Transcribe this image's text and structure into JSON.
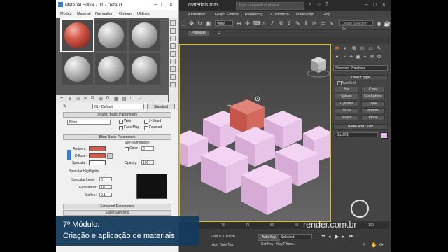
{
  "material_editor": {
    "title": "Material Editor - 01 - Default",
    "menu": [
      "Modes",
      "Material",
      "Navigation",
      "Options",
      "Utilities"
    ],
    "material_name": "01 - Default",
    "material_type": "Standard",
    "rollouts": {
      "shader_basic": "Shader Basic Parameters",
      "blinn_basic": "Blinn Basic Parameters",
      "extended": "Extended Parameters",
      "supersampling": "SuperSampling"
    },
    "shader": {
      "type": "Blinn",
      "wire": "Wire",
      "two_sided": "2-Sided",
      "face_map": "Face Map",
      "faceted": "Faceted"
    },
    "blinn": {
      "self_illumination": "Self-Illumination",
      "color_label": "Color",
      "color_value": "0",
      "ambient": "Ambient:",
      "diffuse": "Diffuse:",
      "specular": "Specular:",
      "opacity_label": "Opacity:",
      "opacity_value": "100",
      "specular_highlights": "Specular Highlights",
      "specular_level_label": "Specular Level:",
      "specular_level_value": "0",
      "glossiness_label": "Glossiness:",
      "glossiness_value": "10",
      "soften_label": "Soften:",
      "soften_value": "0.1",
      "ambient_color": "#d45a4a",
      "diffuse_color": "#d45a4a",
      "specular_color": "#ffffff"
    }
  },
  "max": {
    "title": "materiais.max",
    "search_placeholder": "Type a keyword or phrase",
    "menu": [
      "Animation",
      "Graph Editors",
      "Rendering",
      "Customize",
      "MAXScript",
      "Help"
    ],
    "selection_set_placeholder": "Create Selection Se",
    "view_dropdown": "View",
    "populate": "Populate",
    "command_panel": {
      "dropdown": "Standard Primitives",
      "object_type": "Object Type",
      "autogrid": "AutoGrid",
      "buttons": [
        "Box",
        "Cone",
        "Sphere",
        "GeoSphere",
        "Cylinder",
        "Tube",
        "Torus",
        "Pyramid",
        "Teapot",
        "Plane"
      ],
      "name_and_color": "Name and Color",
      "object_name": "Box001",
      "object_color": "#e6b9e6"
    },
    "timeline_ticks": [
      "70",
      "75",
      "80",
      "85",
      "90",
      "95",
      "100"
    ],
    "status": {
      "grid": "Grid = 10,0cm",
      "auto_key": "Auto Key",
      "selected": "Selected",
      "set_key": "Set Key",
      "key_filters": "Key Filters...",
      "add_time_tag": "Add Time Tag"
    }
  },
  "watermark": "render.com.br",
  "lesson": {
    "line1": "7º Módulo:",
    "line2": "Criação e aplicação de materiais"
  }
}
